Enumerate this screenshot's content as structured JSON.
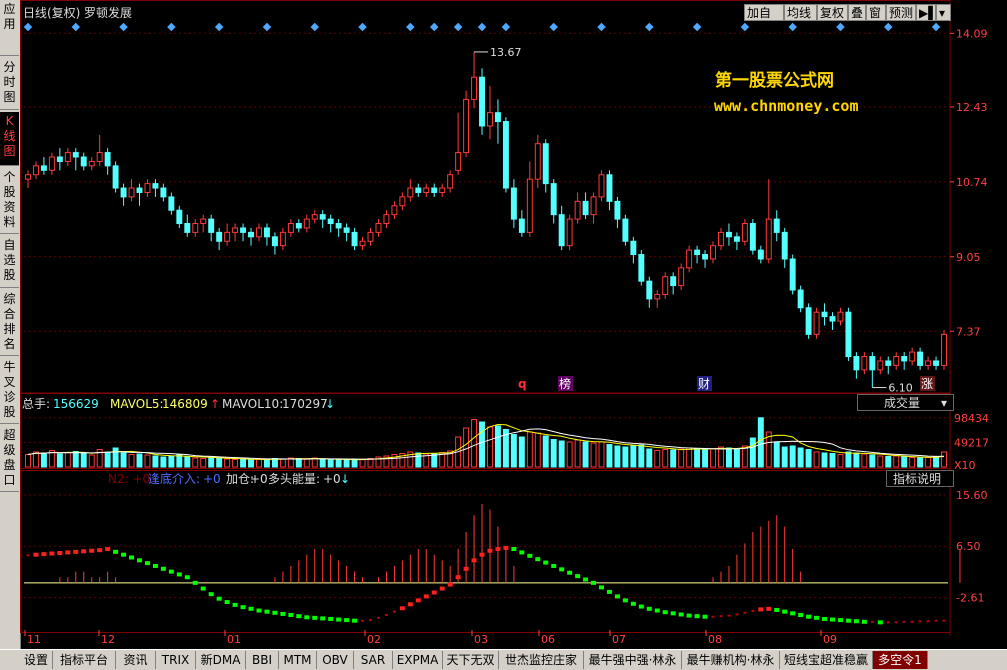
{
  "header": {
    "period": "日线(复权)",
    "stock_name": "罗顿发展",
    "buttons": [
      "加自选",
      "均线",
      "复权",
      "叠",
      "窗",
      "预测",
      "▶▌",
      "▾"
    ]
  },
  "sidebar": {
    "tabs": [
      {
        "label": "应用",
        "active": false
      },
      {
        "label": "分时图",
        "active": false
      },
      {
        "label": "K线图",
        "active": true
      },
      {
        "label": "个股资料",
        "active": false
      },
      {
        "label": "自选股",
        "active": false
      },
      {
        "label": "综合排名",
        "active": false
      },
      {
        "label": "牛叉诊股",
        "active": false
      },
      {
        "label": "超级盘口",
        "active": false
      }
    ]
  },
  "watermark": {
    "line1": "第一股票公式网",
    "line2": "www.chnmoney.com"
  },
  "price_panel": {
    "axis_ticks": [
      "14.09",
      "12.43",
      "10.74",
      "9.05",
      "7.37"
    ],
    "high_label": "13.67",
    "low_label": "6.10",
    "markers": [
      "q",
      "榜",
      "财",
      "涨"
    ]
  },
  "volume_panel": {
    "total_label": "总手:",
    "total_value": "156629",
    "mavol5_label": "MAVOL5:",
    "mavol5_value": "146809",
    "mavol10_label": "MAVOL10:",
    "mavol10_value": "170297",
    "selector": "成交量",
    "axis_ticks": [
      "98434",
      "49217",
      "X10"
    ]
  },
  "indicator_panel": {
    "legend_hidden": "N2: +0",
    "legend_bottom_label": "逢底介入:",
    "legend_bottom_value": "+0",
    "legend_add_label": "加仓:",
    "legend_add_value": "+0",
    "legend_bull_label": "多头能量:",
    "legend_bull_value": "+0",
    "help_button": "指标说明",
    "axis_ticks": [
      "15.60",
      "6.50",
      "-2.61"
    ]
  },
  "x_axis": {
    "labels": [
      "11",
      "12",
      "01",
      "02",
      "03",
      "06",
      "07",
      "08",
      "09"
    ]
  },
  "bottom_tabs": [
    "设置",
    "指标平台",
    "资讯",
    "TRIX",
    "新DMA",
    "BBI",
    "MTM",
    "OBV",
    "SAR",
    "EXPMA",
    "天下无双",
    "世杰监控庄家",
    "最牛强中强·林永",
    "最牛赚机构·林永",
    "短线宝超准稳赢",
    "多空令1"
  ],
  "colors": {
    "up": "#ff3a3a",
    "down": "#54ffff",
    "grid": "#6a0000",
    "axis_text": "#ff4040",
    "ma_white": "#ffffff",
    "ma_yellow": "#ffff00",
    "watermark": "#ffd700",
    "green_dot": "#00ff00",
    "red_dot": "#ff2020"
  },
  "chart_data": {
    "type": "candlestick",
    "price_ylim": [
      6.0,
      14.3
    ],
    "candles": [
      [
        10.8,
        10.9,
        10.6,
        11.0
      ],
      [
        10.9,
        11.1,
        10.8,
        11.2
      ],
      [
        11.1,
        11.0,
        10.9,
        11.3
      ],
      [
        11.0,
        11.3,
        10.9,
        11.4
      ],
      [
        11.3,
        11.2,
        11.0,
        11.5
      ],
      [
        11.2,
        11.4,
        11.1,
        11.5
      ],
      [
        11.4,
        11.3,
        11.0,
        11.5
      ],
      [
        11.3,
        11.1,
        11.0,
        11.4
      ],
      [
        11.1,
        11.2,
        11.0,
        11.3
      ],
      [
        11.2,
        11.4,
        11.1,
        11.8
      ],
      [
        11.4,
        11.1,
        10.9,
        11.5
      ],
      [
        11.1,
        10.6,
        10.5,
        11.2
      ],
      [
        10.6,
        10.4,
        10.2,
        10.7
      ],
      [
        10.4,
        10.6,
        10.3,
        10.8
      ],
      [
        10.6,
        10.5,
        10.2,
        10.7
      ],
      [
        10.5,
        10.7,
        10.4,
        10.8
      ],
      [
        10.7,
        10.6,
        10.4,
        10.8
      ],
      [
        10.6,
        10.4,
        10.3,
        10.7
      ],
      [
        10.4,
        10.1,
        10.0,
        10.5
      ],
      [
        10.1,
        9.8,
        9.7,
        10.2
      ],
      [
        9.8,
        9.6,
        9.5,
        10.0
      ],
      [
        9.6,
        9.8,
        9.5,
        9.9
      ],
      [
        9.8,
        9.9,
        9.6,
        10.0
      ],
      [
        9.9,
        9.6,
        9.4,
        10.0
      ],
      [
        9.6,
        9.4,
        9.2,
        9.7
      ],
      [
        9.4,
        9.6,
        9.3,
        9.8
      ],
      [
        9.6,
        9.7,
        9.4,
        9.8
      ],
      [
        9.7,
        9.6,
        9.4,
        9.8
      ],
      [
        9.6,
        9.5,
        9.3,
        9.7
      ],
      [
        9.5,
        9.7,
        9.4,
        9.8
      ],
      [
        9.7,
        9.5,
        9.3,
        9.8
      ],
      [
        9.5,
        9.3,
        9.1,
        9.6
      ],
      [
        9.3,
        9.6,
        9.2,
        9.7
      ],
      [
        9.6,
        9.8,
        9.5,
        9.9
      ],
      [
        9.8,
        9.7,
        9.6,
        9.9
      ],
      [
        9.7,
        9.9,
        9.6,
        10.0
      ],
      [
        9.9,
        10.0,
        9.8,
        10.1
      ],
      [
        10.0,
        9.9,
        9.7,
        10.1
      ],
      [
        9.9,
        9.8,
        9.6,
        10.0
      ],
      [
        9.8,
        9.7,
        9.5,
        9.9
      ],
      [
        9.7,
        9.6,
        9.4,
        9.8
      ],
      [
        9.6,
        9.3,
        9.2,
        9.7
      ],
      [
        9.3,
        9.4,
        9.2,
        9.5
      ],
      [
        9.4,
        9.6,
        9.3,
        9.7
      ],
      [
        9.6,
        9.8,
        9.5,
        9.9
      ],
      [
        9.8,
        10.0,
        9.7,
        10.1
      ],
      [
        10.0,
        10.2,
        9.9,
        10.3
      ],
      [
        10.2,
        10.4,
        10.1,
        10.5
      ],
      [
        10.4,
        10.6,
        10.3,
        10.8
      ],
      [
        10.6,
        10.5,
        10.4,
        10.7
      ],
      [
        10.5,
        10.6,
        10.4,
        10.7
      ],
      [
        10.6,
        10.5,
        10.4,
        10.7
      ],
      [
        10.5,
        10.6,
        10.4,
        10.7
      ],
      [
        10.6,
        10.9,
        10.5,
        11.0
      ],
      [
        11.0,
        11.4,
        10.9,
        12.3
      ],
      [
        11.4,
        12.6,
        11.3,
        12.8
      ],
      [
        12.6,
        13.1,
        12.4,
        13.67
      ],
      [
        13.1,
        12.0,
        11.8,
        13.3
      ],
      [
        12.0,
        12.3,
        11.7,
        12.9
      ],
      [
        12.3,
        12.1,
        11.6,
        12.6
      ],
      [
        12.1,
        10.6,
        10.5,
        12.2
      ],
      [
        10.6,
        9.9,
        9.7,
        10.8
      ],
      [
        9.9,
        9.6,
        9.5,
        10.1
      ],
      [
        9.6,
        10.8,
        9.5,
        11.2
      ],
      [
        10.8,
        11.6,
        10.6,
        11.8
      ],
      [
        11.6,
        10.7,
        10.5,
        11.7
      ],
      [
        10.7,
        10.0,
        9.8,
        10.8
      ],
      [
        10.0,
        9.3,
        9.2,
        10.2
      ],
      [
        9.3,
        9.9,
        9.2,
        10.0
      ],
      [
        9.9,
        10.3,
        9.8,
        10.5
      ],
      [
        10.3,
        10.0,
        9.9,
        10.5
      ],
      [
        10.0,
        10.4,
        9.8,
        10.5
      ],
      [
        10.4,
        10.9,
        10.3,
        11.0
      ],
      [
        10.9,
        10.3,
        10.1,
        11.0
      ],
      [
        10.3,
        9.9,
        9.7,
        10.4
      ],
      [
        9.9,
        9.4,
        9.3,
        10.0
      ],
      [
        9.4,
        9.1,
        8.9,
        9.5
      ],
      [
        9.1,
        8.5,
        8.4,
        9.2
      ],
      [
        8.5,
        8.1,
        7.9,
        8.6
      ],
      [
        8.1,
        8.2,
        7.9,
        8.3
      ],
      [
        8.2,
        8.6,
        8.1,
        8.7
      ],
      [
        8.6,
        8.4,
        8.2,
        8.7
      ],
      [
        8.4,
        8.8,
        8.3,
        8.9
      ],
      [
        8.8,
        9.2,
        8.7,
        9.3
      ],
      [
        9.2,
        9.1,
        8.9,
        9.3
      ],
      [
        9.1,
        9.0,
        8.8,
        9.2
      ],
      [
        9.0,
        9.3,
        8.9,
        9.4
      ],
      [
        9.3,
        9.6,
        9.2,
        9.7
      ],
      [
        9.6,
        9.5,
        9.3,
        9.8
      ],
      [
        9.5,
        9.4,
        9.2,
        9.6
      ],
      [
        9.4,
        9.8,
        9.3,
        9.9
      ],
      [
        9.8,
        9.2,
        9.1,
        9.9
      ],
      [
        9.2,
        9.0,
        8.9,
        9.3
      ],
      [
        9.0,
        9.9,
        8.9,
        10.8
      ],
      [
        9.9,
        9.6,
        9.4,
        10.1
      ],
      [
        9.6,
        9.0,
        8.8,
        9.7
      ],
      [
        9.0,
        8.3,
        8.2,
        9.1
      ],
      [
        8.3,
        7.9,
        7.8,
        8.4
      ],
      [
        7.9,
        7.3,
        7.2,
        8.0
      ],
      [
        7.3,
        7.8,
        7.2,
        7.9
      ],
      [
        7.8,
        7.7,
        7.5,
        8.0
      ],
      [
        7.7,
        7.6,
        7.4,
        7.8
      ],
      [
        7.6,
        7.8,
        7.5,
        7.9
      ],
      [
        7.8,
        6.8,
        6.7,
        7.9
      ],
      [
        6.8,
        6.5,
        6.3,
        6.9
      ],
      [
        6.5,
        6.8,
        6.4,
        6.9
      ],
      [
        6.8,
        6.5,
        6.1,
        6.9
      ],
      [
        6.5,
        6.7,
        6.4,
        6.8
      ],
      [
        6.7,
        6.6,
        6.4,
        6.8
      ],
      [
        6.6,
        6.8,
        6.5,
        6.9
      ],
      [
        6.8,
        6.7,
        6.5,
        6.9
      ],
      [
        6.7,
        6.9,
        6.6,
        7.0
      ],
      [
        6.9,
        6.6,
        6.5,
        7.0
      ],
      [
        6.6,
        6.7,
        6.5,
        6.8
      ],
      [
        6.7,
        6.6,
        6.5,
        6.8
      ],
      [
        6.6,
        7.3,
        6.5,
        7.4
      ]
    ],
    "volume_ylim": [
      0,
      110000
    ],
    "volume": [
      25000,
      30000,
      28000,
      33000,
      26000,
      29000,
      31000,
      27000,
      24000,
      35000,
      30000,
      38000,
      28000,
      25000,
      26000,
      24000,
      22000,
      20000,
      21000,
      24000,
      20000,
      18000,
      17000,
      19000,
      18000,
      16000,
      15000,
      15000,
      14000,
      16000,
      15000,
      17000,
      16000,
      18000,
      17000,
      16000,
      18000,
      15000,
      14000,
      15000,
      14000,
      16000,
      15000,
      17000,
      20000,
      22000,
      25000,
      27000,
      30000,
      28000,
      26000,
      27000,
      29000,
      32000,
      60000,
      78000,
      95000,
      90000,
      80000,
      82000,
      75000,
      65000,
      60000,
      70000,
      68000,
      62000,
      55000,
      52000,
      50000,
      54000,
      50000,
      48000,
      50000,
      45000,
      42000,
      40000,
      42000,
      44000,
      36000,
      33000,
      35000,
      34000,
      36000,
      38000,
      37000,
      35000,
      36000,
      40000,
      38000,
      36000,
      42000,
      58000,
      98434,
      70000,
      50000,
      40000,
      42000,
      38000,
      35000,
      30000,
      28000,
      27000,
      25000,
      30000,
      28000,
      26000,
      24000,
      22000,
      21000,
      22000,
      20000,
      19000,
      18000,
      19000,
      20000,
      30000
    ],
    "indicator_ylim": [
      -8,
      17
    ],
    "indicator_line": [
      4.9,
      5.0,
      5.1,
      5.2,
      5.3,
      5.4,
      5.5,
      5.6,
      5.7,
      5.8,
      6.0,
      5.5,
      5.0,
      4.5,
      4.0,
      3.5,
      3.0,
      2.5,
      2.0,
      1.5,
      1.0,
      0.0,
      -1.0,
      -2.0,
      -2.8,
      -3.4,
      -3.9,
      -4.3,
      -4.6,
      -4.9,
      -5.1,
      -5.3,
      -5.5,
      -5.7,
      -5.9,
      -6.1,
      -6.2,
      -6.3,
      -6.4,
      -6.5,
      -6.6,
      -6.7,
      -6.7,
      -6.6,
      -6.2,
      -5.7,
      -5.1,
      -4.5,
      -3.8,
      -3.1,
      -2.4,
      -1.7,
      -1.0,
      -0.3,
      1.0,
      2.5,
      4.0,
      5.0,
      5.7,
      6.0,
      6.2,
      6.0,
      5.4,
      4.8,
      4.2,
      3.6,
      3.0,
      2.4,
      1.8,
      1.2,
      0.6,
      0.0,
      -0.8,
      -1.6,
      -2.4,
      -3.1,
      -3.7,
      -4.2,
      -4.6,
      -4.9,
      -5.2,
      -5.4,
      -5.6,
      -5.8,
      -5.9,
      -6.0,
      -6.0,
      -5.9,
      -5.8,
      -5.6,
      -5.3,
      -5.0,
      -4.7,
      -4.6,
      -4.8,
      -5.1,
      -5.4,
      -5.7,
      -6.0,
      -6.2,
      -6.4,
      -6.5,
      -6.6,
      -6.7,
      -6.8,
      -6.9,
      -6.9,
      -7.0,
      -7.0,
      -7.0,
      -6.9,
      -6.9,
      -6.8,
      -6.8,
      -6.7,
      -6.7
    ],
    "indicator_bars": [
      0,
      0,
      0,
      0,
      1,
      1,
      2,
      2,
      1,
      1,
      2,
      1,
      0,
      0,
      0,
      0,
      0,
      0,
      0,
      0,
      0,
      0,
      0,
      0,
      0,
      0,
      0,
      0,
      0,
      0,
      0,
      1,
      2,
      3,
      4,
      5,
      6,
      6,
      5,
      4,
      3,
      2,
      1,
      0,
      1,
      2,
      3,
      4,
      5,
      6,
      6,
      5,
      4,
      3,
      6,
      9,
      12,
      14,
      13,
      10,
      6,
      3,
      0,
      0,
      0,
      0,
      0,
      0,
      0,
      0,
      0,
      0,
      0,
      0,
      0,
      0,
      0,
      0,
      0,
      0,
      0,
      0,
      0,
      0,
      0,
      0,
      1,
      2,
      3,
      5,
      7,
      9,
      10,
      11,
      12,
      10,
      6,
      2,
      0,
      0,
      0,
      0,
      0,
      0,
      0,
      0,
      0,
      0,
      0,
      0,
      0,
      0,
      0,
      0,
      0,
      0,
      0,
      6
    ]
  }
}
